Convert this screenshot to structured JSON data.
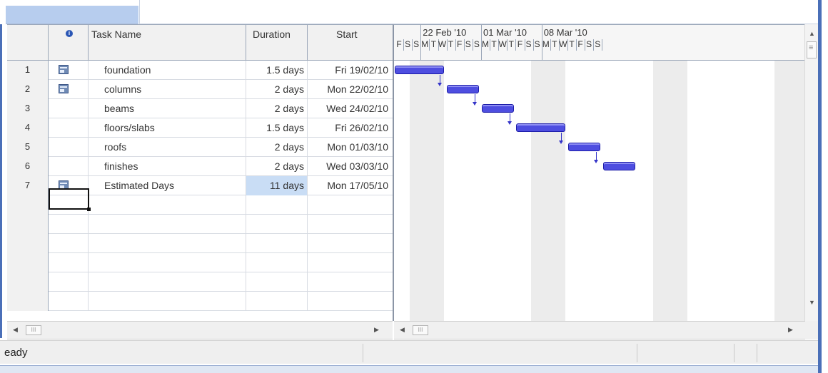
{
  "table": {
    "headers": {
      "indicator_icon": "info-icon",
      "task_name": "Task Name",
      "duration": "Duration",
      "start": "Start"
    },
    "rows": [
      {
        "id": "1",
        "icon": "note-icon",
        "name": "foundation",
        "duration": "1.5 days",
        "start": "Fri 19/02/10"
      },
      {
        "id": "2",
        "icon": "note-icon",
        "name": "columns",
        "duration": "2 days",
        "start": "Mon 22/02/10"
      },
      {
        "id": "3",
        "icon": "",
        "name": "beams",
        "duration": "2 days",
        "start": "Wed 24/02/10"
      },
      {
        "id": "4",
        "icon": "",
        "name": "floors/slabs",
        "duration": "1.5 days",
        "start": "Fri 26/02/10"
      },
      {
        "id": "5",
        "icon": "",
        "name": "roofs",
        "duration": "2 days",
        "start": "Mon 01/03/10"
      },
      {
        "id": "6",
        "icon": "",
        "name": "finishes",
        "duration": "2 days",
        "start": "Wed 03/03/10"
      },
      {
        "id": "7",
        "icon": "note-icon",
        "name": "Estimated Days",
        "duration": "11 days",
        "start": "Mon 17/05/10"
      }
    ],
    "selected_cell": "Estimated Days duration"
  },
  "gantt": {
    "weeks": [
      "22 Feb '10",
      "01 Mar '10",
      "08 Mar '10"
    ],
    "days": [
      "F",
      "S",
      "S",
      "M",
      "T",
      "W",
      "T",
      "F",
      "S",
      "S",
      "M",
      "T",
      "W",
      "T",
      "F",
      "S",
      "S",
      "M",
      "T",
      "W",
      "T",
      "F",
      "S",
      "S"
    ],
    "bar_color": "#4e4ee0"
  },
  "scroll": {
    "thumb_label": "III"
  },
  "status_bar": {
    "text": "eady"
  }
}
